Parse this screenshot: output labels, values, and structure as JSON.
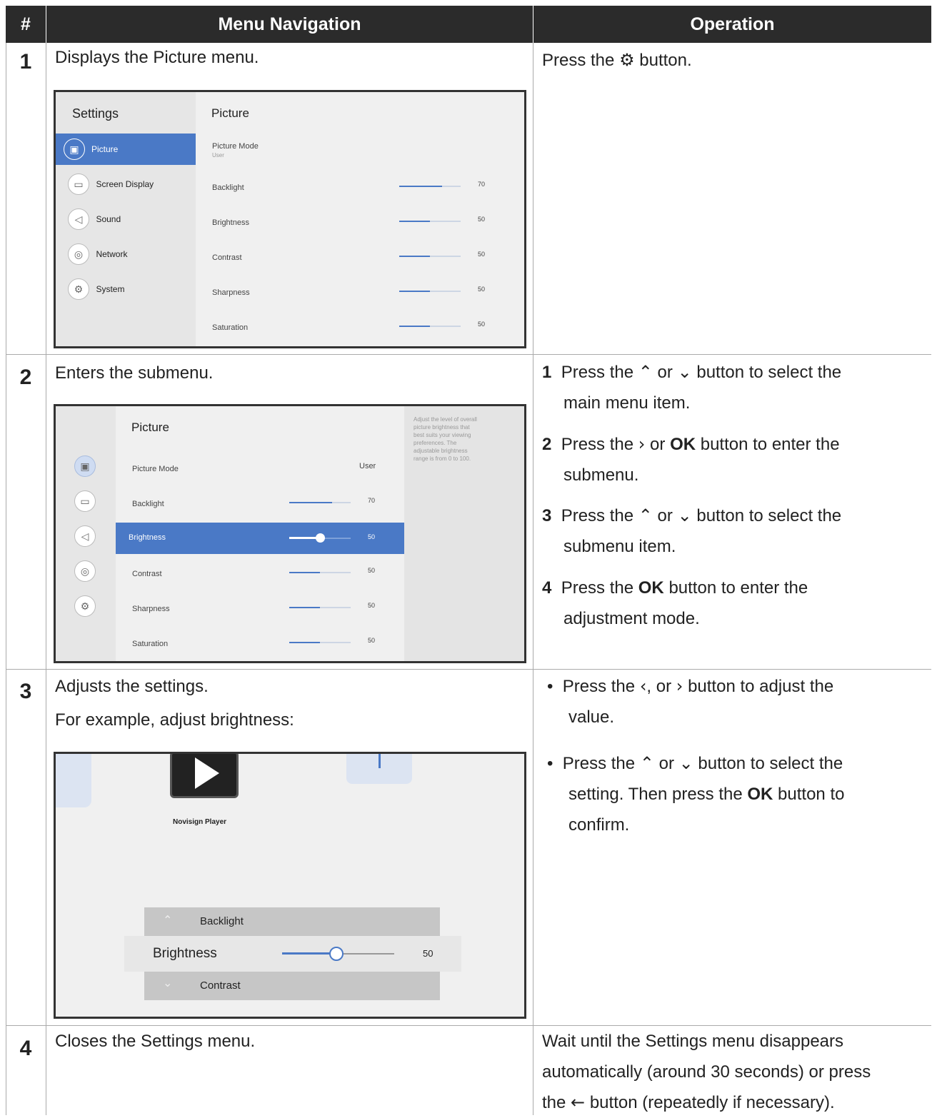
{
  "header": {
    "col_num": "#",
    "col_nav": "Menu Navigation",
    "col_op": "Operation"
  },
  "rows": [
    {
      "num": "1",
      "nav": "Displays the Picture menu.",
      "op_prefix": "Press the",
      "op_icon": "gear-icon",
      "op_suffix": "button."
    },
    {
      "num": "2",
      "nav": "Enters the submenu.",
      "steps": [
        {
          "n": "1",
          "t1": "Press the",
          "i1": "up-chevron-icon",
          "t2": "or",
          "i2": "down-chevron-icon",
          "t3": "button to select the",
          "t4": "main menu item."
        },
        {
          "n": "2",
          "t1": "Press the",
          "i1": "right-chevron-icon",
          "t2": "or",
          "bold": "OK",
          "t3": "button to enter the",
          "t4": "submenu."
        },
        {
          "n": "3",
          "t1": "Press the",
          "i1": "up-chevron-icon",
          "t2": "or",
          "i2": "down-chevron-icon",
          "t3": "button to select the",
          "t4": "submenu item."
        },
        {
          "n": "4",
          "t1": "Press the",
          "bold": "OK",
          "t3": "button to enter the",
          "t4": "adjustment mode."
        }
      ]
    },
    {
      "num": "3",
      "nav": "Adjusts the settings.",
      "nav2": "For example, adjust brightness:",
      "bullets": [
        {
          "t1": "Press the",
          "i1": "left-chevron-icon",
          "t2": ", or",
          "i2": "right-chevron-icon",
          "t3": "button to adjust the",
          "t4": "value."
        },
        {
          "t1": "Press the",
          "i1": "up-chevron-icon",
          "t2": "or",
          "i2": "down-chevron-icon",
          "t3": "button to select the",
          "t4": "setting. Then press the",
          "bold": "OK",
          "t5": "button to",
          "t6": "confirm."
        }
      ]
    },
    {
      "num": "4",
      "nav": "Closes the Settings menu.",
      "op_lines": [
        "Wait until the Settings menu disappears",
        "automatically (around 30 seconds) or press"
      ],
      "op_last_prefix": "the",
      "op_last_icon": "back-arrow-icon",
      "op_last_suffix": "button (repeatedly if necessary)."
    }
  ],
  "screen1": {
    "title": "Settings",
    "panel_title": "Picture",
    "menu": [
      "Picture",
      "Screen Display",
      "Sound",
      "Network",
      "System"
    ],
    "picture_mode_label": "Picture Mode",
    "picture_mode_value": "User",
    "items": [
      {
        "label": "Backlight",
        "value": "70",
        "level": 0.7
      },
      {
        "label": "Brightness",
        "value": "50",
        "level": 0.5
      },
      {
        "label": "Contrast",
        "value": "50",
        "level": 0.5
      },
      {
        "label": "Sharpness",
        "value": "50",
        "level": 0.5
      },
      {
        "label": "Saturation",
        "value": "50",
        "level": 0.5
      }
    ]
  },
  "screen2": {
    "panel_title": "Picture",
    "picture_mode_label": "Picture Mode",
    "picture_mode_value": "User",
    "items": [
      {
        "label": "Backlight",
        "value": "70",
        "level": 0.7
      },
      {
        "label": "Brightness",
        "value": "50",
        "level": 0.5
      },
      {
        "label": "Contrast",
        "value": "50",
        "level": 0.5
      },
      {
        "label": "Sharpness",
        "value": "50",
        "level": 0.5
      },
      {
        "label": "Saturation",
        "value": "50",
        "level": 0.5
      }
    ],
    "help": [
      "Adjust the level of overall",
      "picture brightness that",
      "best suits your viewing",
      "preferences. The",
      "adjustable brightness",
      "range is from 0 to 100."
    ]
  },
  "screen3": {
    "app_label": "Novisign Player",
    "prev": "Backlight",
    "current": "Brightness",
    "current_value": "50",
    "current_level": 0.5,
    "next": "Contrast"
  }
}
